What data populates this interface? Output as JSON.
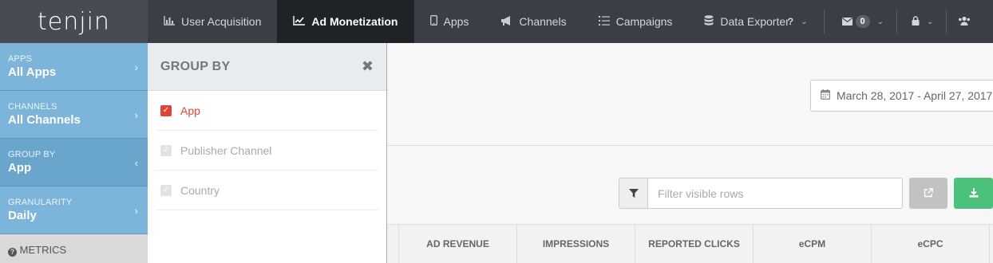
{
  "brand": {
    "name": "tenjin"
  },
  "nav": {
    "items": [
      {
        "label": "User Acquisition",
        "icon": "bar-chart-icon"
      },
      {
        "label": "Ad Monetization",
        "icon": "line-chart-icon",
        "active": true
      },
      {
        "label": "Apps",
        "icon": "mobile-icon"
      },
      {
        "label": "Channels",
        "icon": "bullhorn-icon"
      },
      {
        "label": "Campaigns",
        "icon": "list-icon"
      },
      {
        "label": "Data Exporter",
        "icon": "database-icon"
      }
    ],
    "messages_count": "0"
  },
  "sidebar": {
    "items": [
      {
        "caption": "APPS",
        "value": "All Apps"
      },
      {
        "caption": "CHANNELS",
        "value": "All Channels"
      },
      {
        "caption": "GROUP BY",
        "value": "App"
      },
      {
        "caption": "GRANULARITY",
        "value": "Daily"
      }
    ],
    "metrics_label": "METRICS"
  },
  "group_panel": {
    "title": "GROUP BY",
    "options": [
      {
        "label": "App",
        "checked": true
      },
      {
        "label": "Publisher Channel",
        "checked": false
      },
      {
        "label": "Country",
        "checked": false
      }
    ]
  },
  "main": {
    "date_range": "March 28, 2017 - April 27, 2017",
    "filter": {
      "placeholder": "Filter visible rows"
    },
    "columns": [
      "AD REVENUE",
      "IMPRESSIONS",
      "REPORTED CLICKS",
      "eCPM",
      "eCPC"
    ]
  },
  "colors": {
    "nav_bg": "#3a3f46",
    "nav_active": "#1f2226",
    "sidebar_bg": "#7fb6da",
    "checked_red": "#e0453a",
    "download_green": "#4cc17b"
  }
}
